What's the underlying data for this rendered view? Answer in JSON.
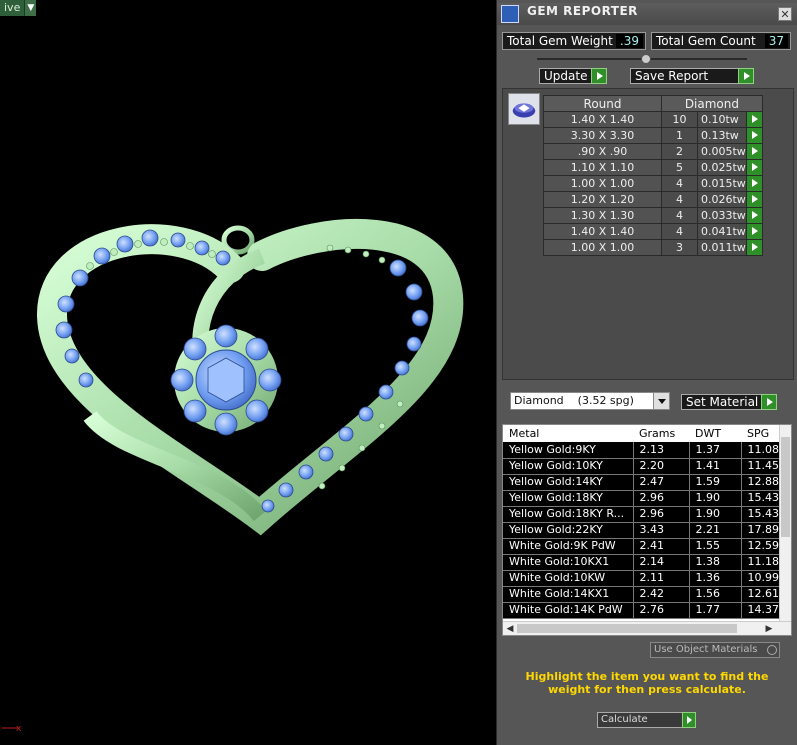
{
  "viewport": {
    "tab_label": "ive"
  },
  "panel": {
    "title": "GEM REPORTER",
    "total_gem_weight_label": "Total Gem Weight",
    "total_gem_weight": ".39",
    "total_gem_count_label": "Total Gem Count",
    "total_gem_count": "37",
    "update_label": "Update",
    "save_report_label": "Save Report",
    "gem_table": {
      "shape_header": "Round",
      "material_header": "Diamond",
      "rows": [
        {
          "size": "1.40 X 1.40",
          "count": "10",
          "weight": "0.10tw"
        },
        {
          "size": "3.30 X 3.30",
          "count": "1",
          "weight": "0.13tw"
        },
        {
          "size": ".90 X .90",
          "count": "2",
          "weight": "0.005tw"
        },
        {
          "size": "1.10 X 1.10",
          "count": "5",
          "weight": "0.025tw"
        },
        {
          "size": "1.00 X 1.00",
          "count": "4",
          "weight": "0.015tw"
        },
        {
          "size": "1.20 X 1.20",
          "count": "4",
          "weight": "0.026tw"
        },
        {
          "size": "1.30 X 1.30",
          "count": "4",
          "weight": "0.033tw"
        },
        {
          "size": "1.40 X 1.40",
          "count": "4",
          "weight": "0.041tw"
        },
        {
          "size": "1.00 X 1.00",
          "count": "3",
          "weight": "0.011tw"
        }
      ]
    },
    "material_select_value": "Diamond    (3.52 spg)",
    "set_material_label": "Set Material",
    "metal_table": {
      "headers": [
        "Metal",
        "Grams",
        "DWT",
        "SPG"
      ],
      "rows": [
        {
          "metal": "Yellow Gold:9KY",
          "grams": "2.13",
          "dwt": "1.37",
          "spg": "11.08"
        },
        {
          "metal": "Yellow Gold:10KY",
          "grams": "2.20",
          "dwt": "1.41",
          "spg": "11.45"
        },
        {
          "metal": "Yellow Gold:14KY",
          "grams": "2.47",
          "dwt": "1.59",
          "spg": "12.88"
        },
        {
          "metal": "Yellow Gold:18KY",
          "grams": "2.96",
          "dwt": "1.90",
          "spg": "15.43"
        },
        {
          "metal": "Yellow Gold:18KY R...",
          "grams": "2.96",
          "dwt": "1.90",
          "spg": "15.43"
        },
        {
          "metal": "Yellow Gold:22KY",
          "grams": "3.43",
          "dwt": "2.21",
          "spg": "17.89"
        },
        {
          "metal": "White Gold:9K PdW",
          "grams": "2.41",
          "dwt": "1.55",
          "spg": "12.59"
        },
        {
          "metal": "White Gold:10KX1",
          "grams": "2.14",
          "dwt": "1.38",
          "spg": "11.18"
        },
        {
          "metal": "White Gold:10KW",
          "grams": "2.11",
          "dwt": "1.36",
          "spg": "10.99"
        },
        {
          "metal": "White Gold:14KX1",
          "grams": "2.42",
          "dwt": "1.56",
          "spg": "12.61"
        },
        {
          "metal": "White Gold:14K PdW",
          "grams": "2.76",
          "dwt": "1.77",
          "spg": "14.37"
        }
      ]
    },
    "use_object_materials_label": "Use Object Materials",
    "hint_text": "Highlight the item you want to find the weight for then press calculate.",
    "calculate_label": "Calculate"
  },
  "colors": {
    "metal": "#b6e8b6",
    "gem": "#6e9cf0",
    "accent_green": "#2f8f28",
    "hint": "#ffd800"
  }
}
